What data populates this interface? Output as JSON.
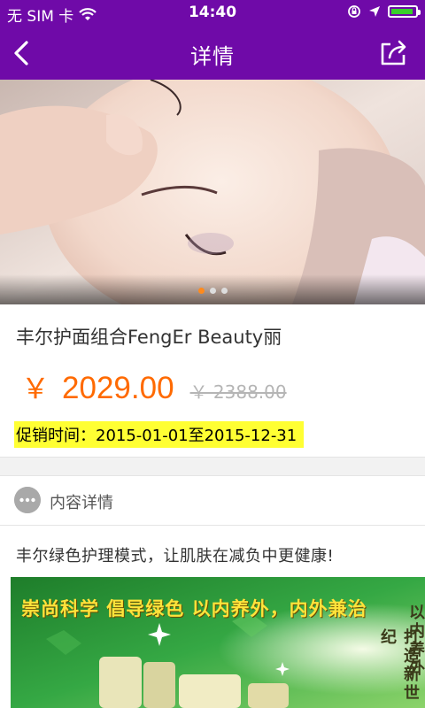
{
  "status_bar": {
    "carrier": "无 SIM 卡",
    "time": "14:40"
  },
  "nav": {
    "title": "详情"
  },
  "carousel": {
    "dot_count": 3,
    "active_index": 0
  },
  "product": {
    "title": "丰尔护面组合FengEr Beauty丽",
    "currency_symbol": "￥",
    "price": "2029.00",
    "original_price": "￥ 2388.00",
    "promo_text": "促销时间：2015-01-01至2015-12-31"
  },
  "section": {
    "label": "内容详情"
  },
  "content": {
    "description": "丰尔绿色护理模式，让肌肤在减负中更健康!",
    "banner_headline": "崇尚科学 倡导绿色 以内养外，内外兼治",
    "banner_vertical_1": "打造新世纪",
    "banner_vertical_2": "以内养外"
  },
  "colors": {
    "brand_purple": "#6f0aa8",
    "price_orange": "#ff6a00",
    "promo_highlight": "#ffff33"
  },
  "icons": {
    "back": "back-chevron-icon",
    "share": "share-icon",
    "section": "more-dots-icon"
  }
}
